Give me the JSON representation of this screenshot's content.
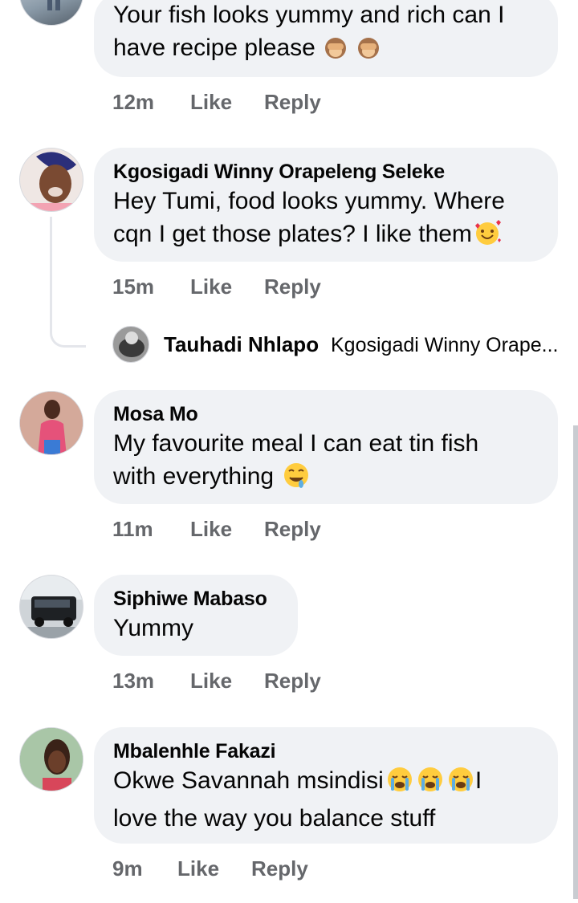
{
  "comments": [
    {
      "text": "Your fish looks yummy and rich can I have recipe please",
      "emojis": [
        "see-no-evil-monkey",
        "see-no-evil-monkey"
      ],
      "time": "12m",
      "like": "Like",
      "reply": "Reply"
    },
    {
      "name": "Kgosigadi Winny Orapeleng Seleke",
      "text_line1": "Hey Tumi, food looks yummy. Where",
      "text_line2": "cqn I get those plates? I like them",
      "emojis": [
        "smiling-face-with-hearts"
      ],
      "time": "15m",
      "like": "Like",
      "reply": "Reply"
    },
    {
      "name": "Mosa Mo",
      "text_line1": "My favourite meal I can eat tin fish",
      "text_line2": "with everything",
      "emojis": [
        "drooling-face"
      ],
      "time": "11m",
      "like": "Like",
      "reply": "Reply"
    },
    {
      "name": "Siphiwe Mabaso",
      "text": "Yummy",
      "time": "13m",
      "like": "Like",
      "reply": "Reply"
    },
    {
      "name": "Mbalenhle Fakazi",
      "text_line1a": "Okwe Savannah msindisi",
      "text_line1b": "I",
      "text_line2": "love the way you balance stuff",
      "emojis": [
        "loudly-crying-face",
        "loudly-crying-face",
        "loudly-crying-face"
      ],
      "time": "9m",
      "like": "Like",
      "reply": "Reply"
    }
  ],
  "reply_preview": {
    "name": "Tauhadi Nhlapo",
    "text": "Kgosigadi Winny Orape..."
  },
  "colors": {
    "bubble": "#f0f2f5",
    "meta": "#65676b",
    "text": "#050505"
  }
}
